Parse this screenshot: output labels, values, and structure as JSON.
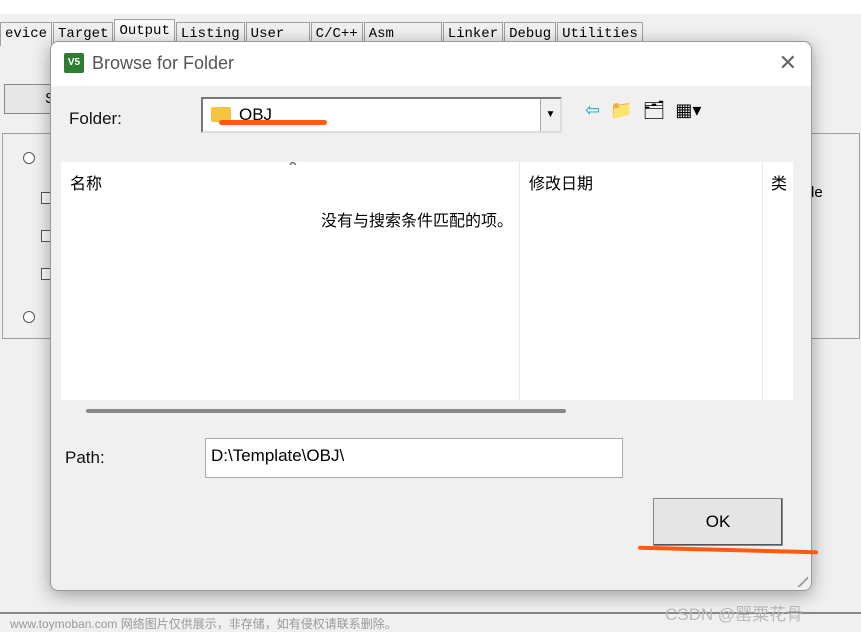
{
  "background": {
    "tabs": [
      "evice",
      "Target",
      "Output",
      "Listing",
      "User",
      "C/C++",
      "Asm",
      "Linker",
      "Debug",
      "Utilities"
    ],
    "active_tab": "Output",
    "partial_button": "S",
    "partial_right_text": "le"
  },
  "dialog": {
    "title": "Browse for Folder",
    "app_icon_text": "V5",
    "folder_label": "Folder:",
    "folder_value": "OBJ",
    "columns": [
      "名称",
      "修改日期",
      "类"
    ],
    "empty_message": "没有与搜索条件匹配的项。",
    "path_label": "Path:",
    "path_value": "D:\\Template\\OBJ\\",
    "ok_label": "OK",
    "annotation_color": "#ff5a10"
  },
  "watermark": "www.toymoban.com 网络图片仅供展示，非存储，如有侵权请联系删除。",
  "csdn_mark": "CSDN @罂粟花骨"
}
